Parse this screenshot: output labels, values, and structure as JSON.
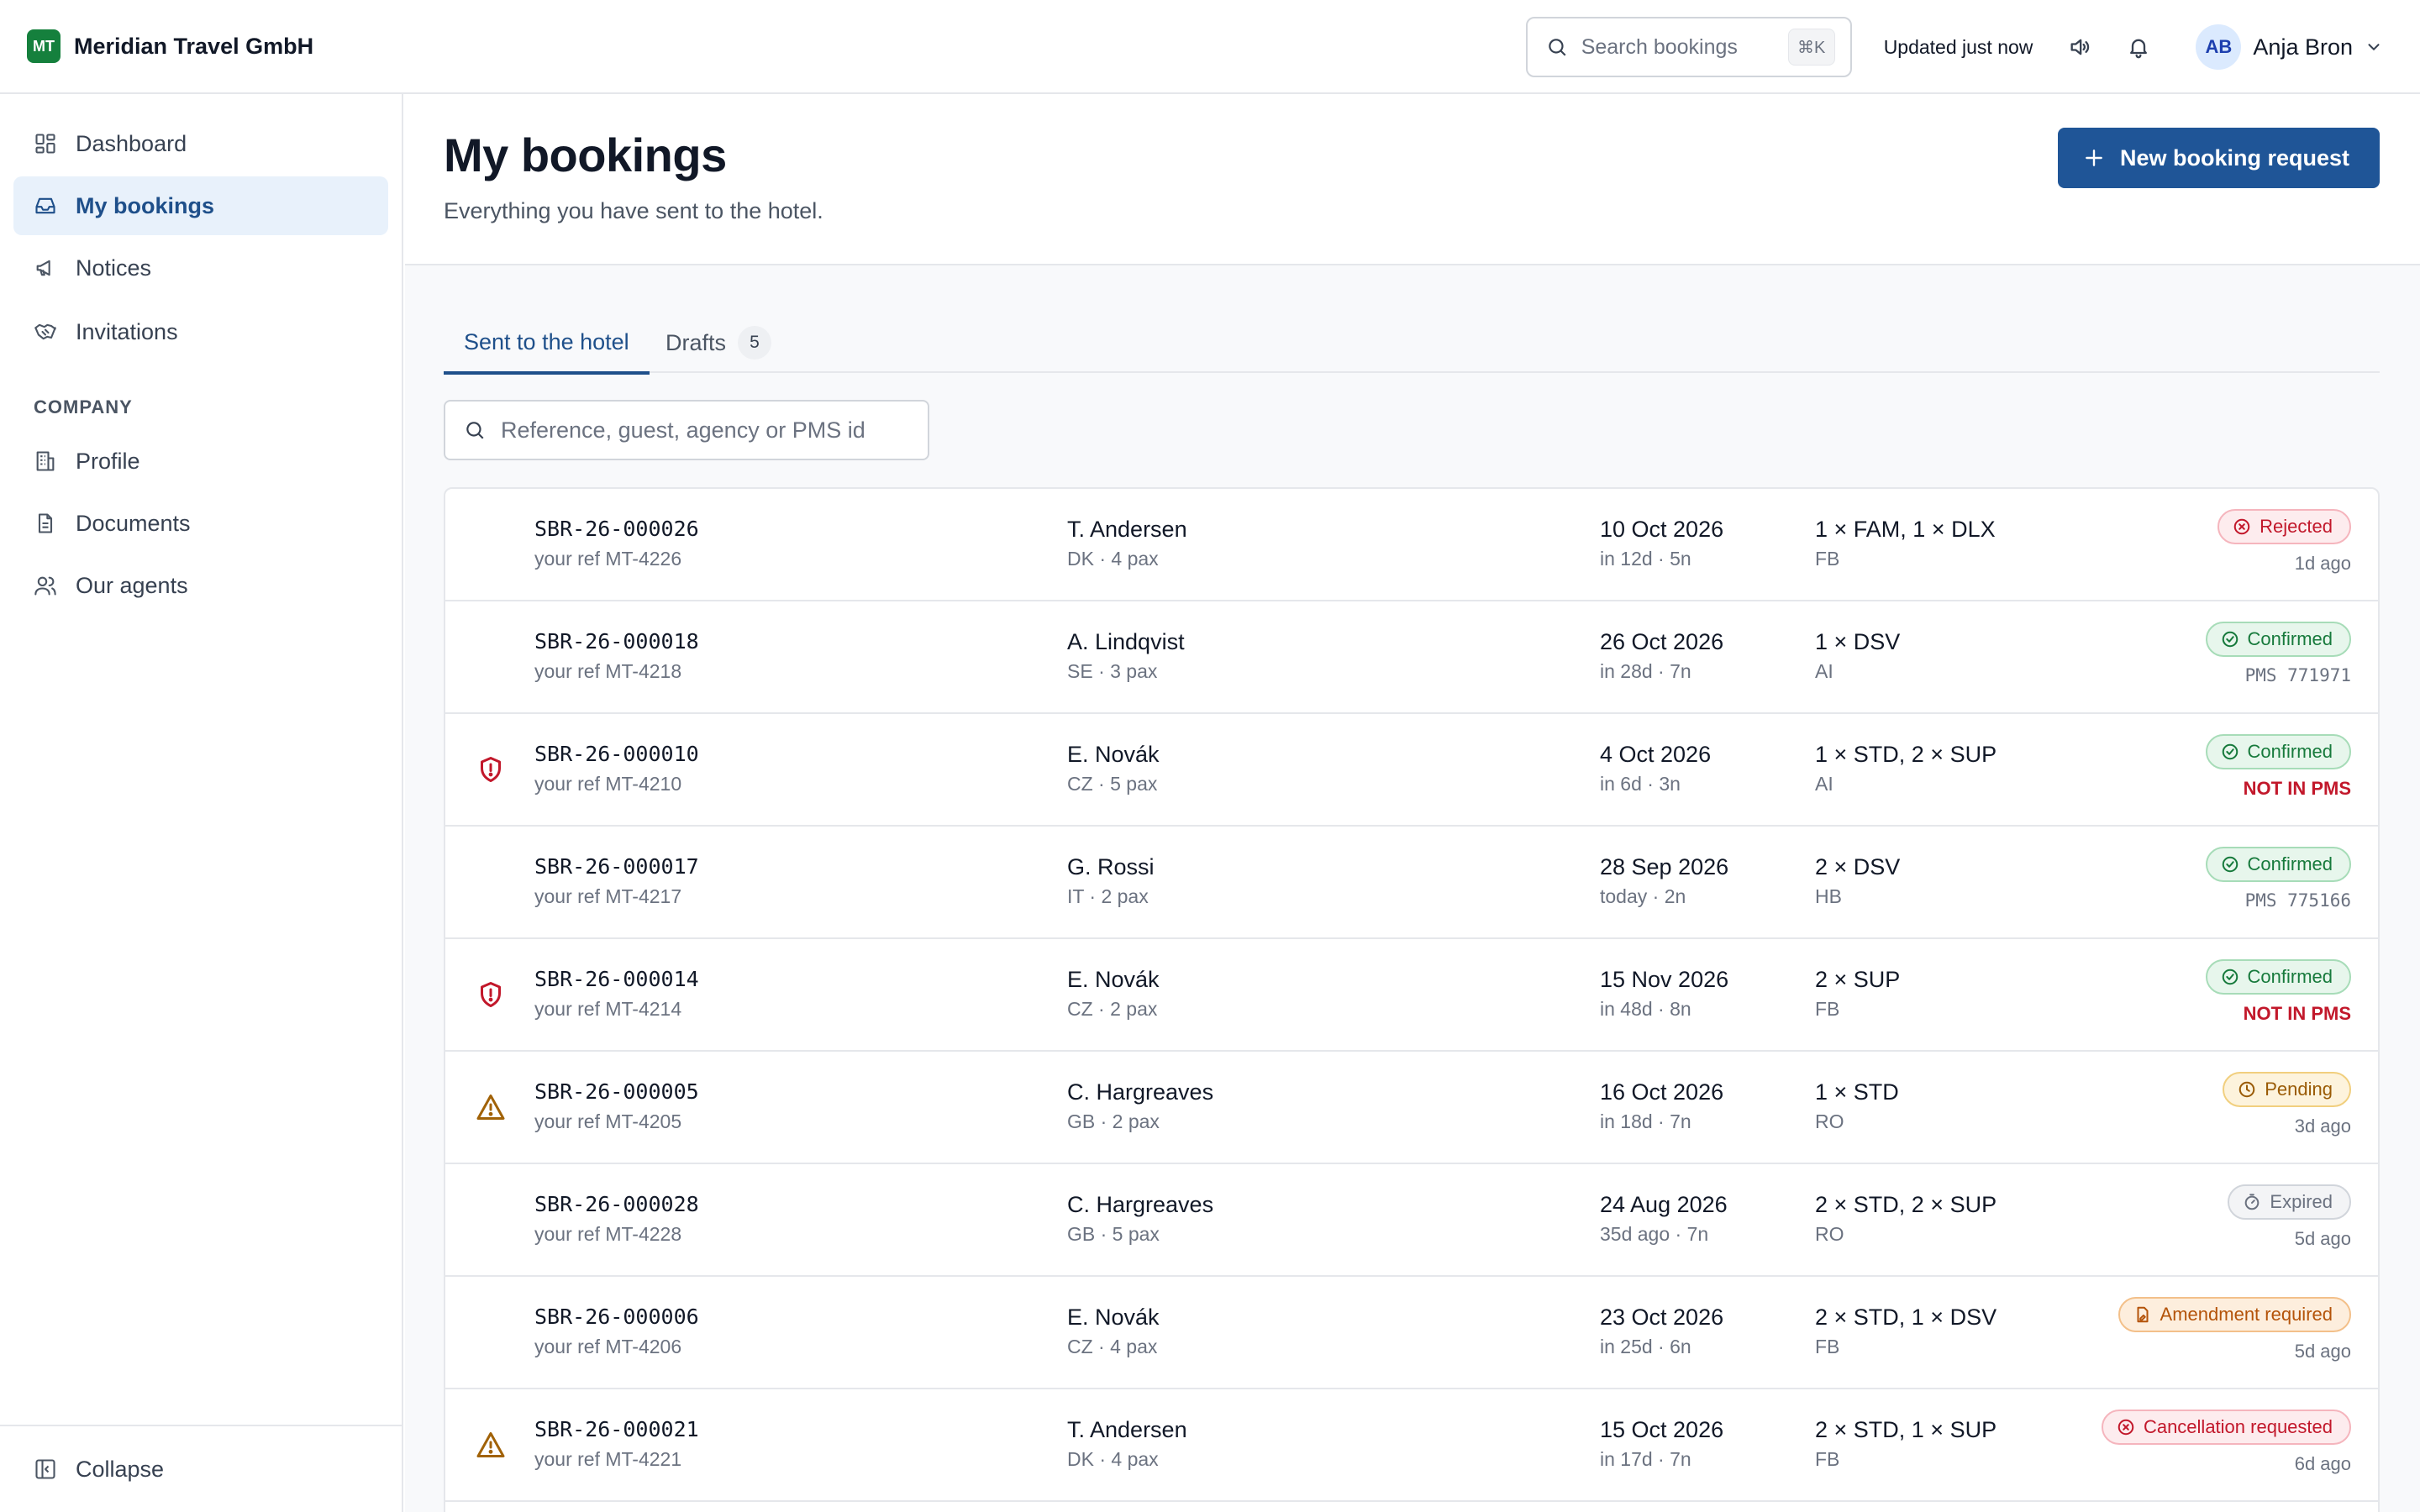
{
  "brand": {
    "logo": "MT",
    "name": "Meridian Travel GmbH"
  },
  "topbar": {
    "search_placeholder": "Search bookings",
    "search_shortcut": "⌘K",
    "updated": "Updated just now",
    "user_initials": "AB",
    "user_name": "Anja Bron"
  },
  "sidebar": {
    "items": [
      {
        "label": "Dashboard",
        "icon": "dashboard-icon"
      },
      {
        "label": "My bookings",
        "icon": "inbox-icon"
      },
      {
        "label": "Notices",
        "icon": "megaphone-icon"
      },
      {
        "label": "Invitations",
        "icon": "handshake-icon"
      }
    ],
    "section_label": "COMPANY",
    "company_items": [
      {
        "label": "Profile",
        "icon": "building-icon"
      },
      {
        "label": "Documents",
        "icon": "document-icon"
      },
      {
        "label": "Our agents",
        "icon": "users-icon"
      }
    ],
    "collapse_label": "Collapse"
  },
  "page": {
    "title": "My bookings",
    "subtitle": "Everything you have sent to the hotel.",
    "new_button": "New booking request"
  },
  "tabs": [
    {
      "label": "Sent to the hotel",
      "active": true
    },
    {
      "label": "Drafts",
      "count": "5"
    }
  ],
  "filter": {
    "placeholder": "Reference, guest, agency or PMS id"
  },
  "colors": {
    "accent": "#1f5597",
    "brand": "#15803d",
    "alert": "#c2182b"
  },
  "bookings": [
    {
      "ref": "SBR-26-000026",
      "your_ref": "your ref MT-4226",
      "guest": "T. Andersen",
      "guest_meta": "DK · 4 pax",
      "date": "10 Oct 2026",
      "date_meta": "in 12d · 5n",
      "rooms": "1 × FAM, 1 × DLX",
      "board": "FB",
      "status": "Rejected",
      "status_sub": "1d ago",
      "flag": ""
    },
    {
      "ref": "SBR-26-000018",
      "your_ref": "your ref MT-4218",
      "guest": "A. Lindqvist",
      "guest_meta": "SE · 3 pax",
      "date": "26 Oct 2026",
      "date_meta": "in 28d · 7n",
      "rooms": "1 × DSV",
      "board": "AI",
      "status": "Confirmed",
      "status_sub": "PMS 771971",
      "flag": ""
    },
    {
      "ref": "SBR-26-000010",
      "your_ref": "your ref MT-4210",
      "guest": "E. Novák",
      "guest_meta": "CZ · 5 pax",
      "date": "4 Oct 2026",
      "date_meta": "in 6d · 3n",
      "rooms": "1 × STD, 2 × SUP",
      "board": "AI",
      "status": "Confirmed",
      "status_sub": "NOT IN PMS",
      "flag": "shield-alert-icon"
    },
    {
      "ref": "SBR-26-000017",
      "your_ref": "your ref MT-4217",
      "guest": "G. Rossi",
      "guest_meta": "IT · 2 pax",
      "date": "28 Sep 2026",
      "date_meta": "today · 2n",
      "rooms": "2 × DSV",
      "board": "HB",
      "status": "Confirmed",
      "status_sub": "PMS 775166",
      "flag": ""
    },
    {
      "ref": "SBR-26-000014",
      "your_ref": "your ref MT-4214",
      "guest": "E. Novák",
      "guest_meta": "CZ · 2 pax",
      "date": "15 Nov 2026",
      "date_meta": "in 48d · 8n",
      "rooms": "2 × SUP",
      "board": "FB",
      "status": "Confirmed",
      "status_sub": "NOT IN PMS",
      "flag": "shield-alert-icon"
    },
    {
      "ref": "SBR-26-000005",
      "your_ref": "your ref MT-4205",
      "guest": "C. Hargreaves",
      "guest_meta": "GB · 2 pax",
      "date": "16 Oct 2026",
      "date_meta": "in 18d · 7n",
      "rooms": "1 × STD",
      "board": "RO",
      "status": "Pending",
      "status_sub": "3d ago",
      "flag": "warning-icon"
    },
    {
      "ref": "SBR-26-000028",
      "your_ref": "your ref MT-4228",
      "guest": "C. Hargreaves",
      "guest_meta": "GB · 5 pax",
      "date": "24 Aug 2026",
      "date_meta": "35d ago · 7n",
      "rooms": "2 × STD, 2 × SUP",
      "board": "RO",
      "status": "Expired",
      "status_sub": "5d ago",
      "flag": ""
    },
    {
      "ref": "SBR-26-000006",
      "your_ref": "your ref MT-4206",
      "guest": "E. Novák",
      "guest_meta": "CZ · 4 pax",
      "date": "23 Oct 2026",
      "date_meta": "in 25d · 6n",
      "rooms": "2 × STD, 1 × DSV",
      "board": "FB",
      "status": "Amendment required",
      "status_sub": "5d ago",
      "flag": ""
    },
    {
      "ref": "SBR-26-000021",
      "your_ref": "your ref MT-4221",
      "guest": "T. Andersen",
      "guest_meta": "DK · 4 pax",
      "date": "15 Oct 2026",
      "date_meta": "in 17d · 7n",
      "rooms": "2 × STD, 1 × SUP",
      "board": "FB",
      "status": "Cancellation requested",
      "status_sub": "6d ago",
      "flag": "warning-icon"
    }
  ]
}
